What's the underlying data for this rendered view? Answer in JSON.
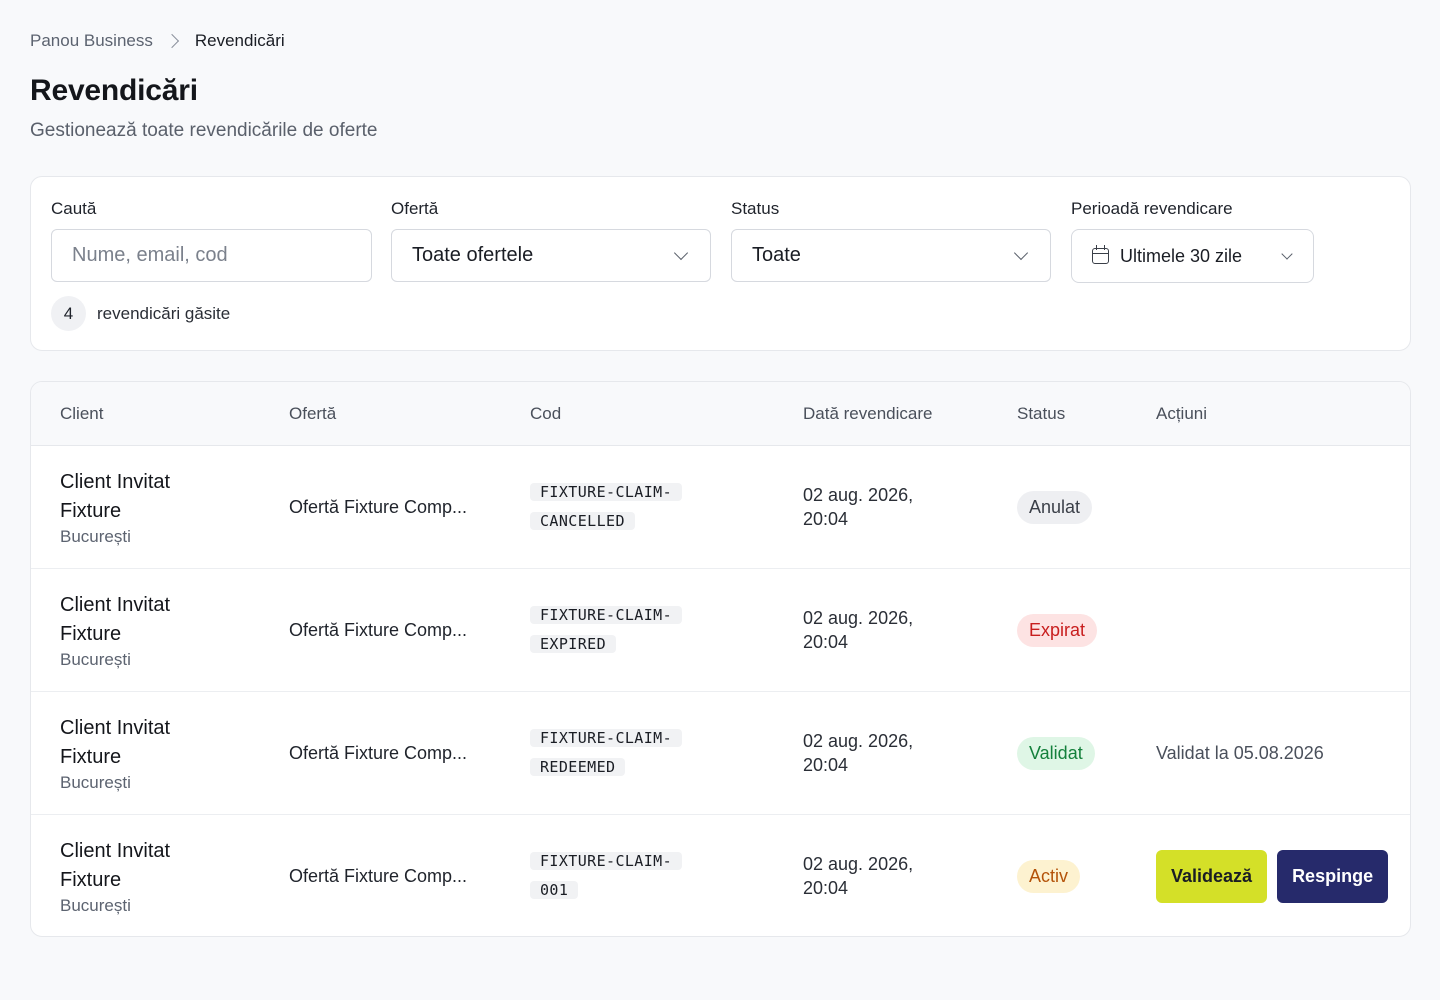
{
  "breadcrumb": {
    "parent": "Panou Business",
    "current": "Revendicări"
  },
  "page": {
    "title": "Revendicări",
    "subtitle": "Gestionează toate revendicările de oferte"
  },
  "filters": {
    "search": {
      "label": "Caută",
      "placeholder": "Nume, email, cod",
      "value": ""
    },
    "offer": {
      "label": "Ofertă",
      "value": "Toate ofertele"
    },
    "status": {
      "label": "Status",
      "value": "Toate"
    },
    "period": {
      "label": "Perioadă revendicare",
      "value": "Ultimele 30 zile",
      "icon": "calendar-icon"
    }
  },
  "results": {
    "count": "4",
    "text": "revendicări găsite"
  },
  "table": {
    "columns": [
      "Client",
      "Ofertă",
      "Cod",
      "Dată revendicare",
      "Status",
      "Acțiuni"
    ],
    "rows": [
      {
        "client": "Client Invitat Fixture",
        "city": "București",
        "offer": "Ofertă Fixture Comp...",
        "code": "FIXTURE-CLAIM-CANCELLED",
        "date": "02 aug. 2026, 20:04",
        "status": "Anulat",
        "action_text": ""
      },
      {
        "client": "Client Invitat Fixture",
        "city": "București",
        "offer": "Ofertă Fixture Comp...",
        "code": "FIXTURE-CLAIM-EXPIRED",
        "date": "02 aug. 2026, 20:04",
        "status": "Expirat",
        "action_text": ""
      },
      {
        "client": "Client Invitat Fixture",
        "city": "București",
        "offer": "Ofertă Fixture Comp...",
        "code": "FIXTURE-CLAIM-REDEEMED",
        "date": "02 aug. 2026, 20:04",
        "status": "Validat",
        "action_text": "Validat la 05.08.2026"
      },
      {
        "client": "Client Invitat Fixture",
        "city": "București",
        "offer": "Ofertă Fixture Comp...",
        "code": "FIXTURE-CLAIM-001",
        "date": "02 aug. 2026, 20:04",
        "status": "Activ",
        "action_text": "",
        "buttons": {
          "validate": "Validează",
          "reject": "Respinge"
        }
      }
    ]
  },
  "status_colors": {
    "Anulat": {
      "bg": "#eeeff2",
      "fg": "#3a3f48"
    },
    "Expirat": {
      "bg": "#fde3e3",
      "fg": "#c81e1e"
    },
    "Validat": {
      "bg": "#dff6e6",
      "fg": "#14803c"
    },
    "Activ": {
      "bg": "#fdf2d0",
      "fg": "#b45309"
    }
  },
  "colors": {
    "validate_button": "#d4e028",
    "reject_button": "#262a6b"
  }
}
